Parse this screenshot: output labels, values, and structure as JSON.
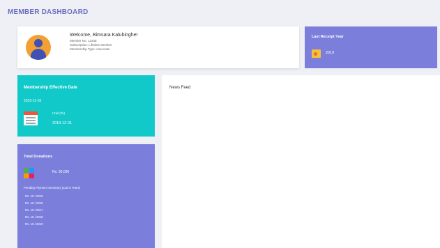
{
  "page": {
    "title": "MEMBER DASHBOARD"
  },
  "welcome": {
    "greeting": "Welcome, Bimsara Kalubinghe!",
    "lines": [
      "Member No. 12345",
      "Subscription: Lifetime Member",
      "Membership Type: Associate"
    ]
  },
  "receipt": {
    "title": "Last Receipt Year",
    "value": "2019",
    "icon": "receipt-icon"
  },
  "membership": {
    "title": "Membership Effective Date",
    "start_date": "2015-11-16",
    "end_label": "Until (To)",
    "end_date": "2019-12-31",
    "icon": "calendar-icon"
  },
  "donation": {
    "title": "Total Donations",
    "amount": "Rs. 30,000",
    "note": "Pending Payment Summary (Last 5 Years)",
    "items": [
      "Rs. 10 / 2015",
      "Rs. 10 / 2016",
      "Rs. 10 / 2017",
      "Rs. 10 / 2018",
      "Rs. 10 / 2019"
    ],
    "icon": "chart-icon"
  },
  "news": {
    "title": "News Feed"
  },
  "colors": {
    "accent_purple": "#7b7fdb",
    "accent_cyan": "#11c9c9",
    "avatar_orange": "#f2a033"
  }
}
